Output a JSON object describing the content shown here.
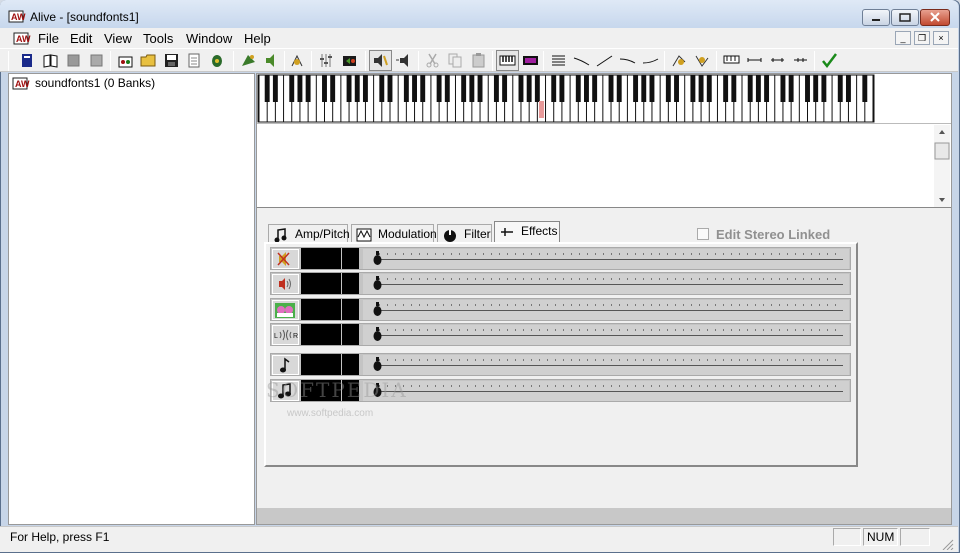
{
  "window": {
    "title": "Alive - [soundfonts1]",
    "title_icon": "alive-app-icon",
    "controls": [
      "minimize-icon",
      "maximize-icon",
      "close-icon"
    ]
  },
  "menubar": {
    "items": [
      "File",
      "Edit",
      "View",
      "Tools",
      "Window",
      "Help"
    ],
    "mdi_controls": [
      "minimize-icon",
      "restore-icon",
      "close-icon"
    ]
  },
  "toolbar": {
    "icons": [
      "new-bank-icon",
      "open-book-icon",
      "gray-box-icon",
      "gray-box-2-icon",
      "instrument-icon",
      "open-folder-icon",
      "save-icon",
      "page-icon",
      "bug-icon",
      "leaf-icon",
      "speaker-tool-icon",
      "mixer-icon",
      "equalizer-icon",
      "speaker-play-icon",
      "speaker-stop-icon",
      "cut-icon",
      "copy-icon",
      "paste-icon",
      "keyboard-icon",
      "purple-display-icon",
      "lines-icon",
      "line-diag-icon",
      "line-diag-2-icon",
      "curve-icon",
      "curve-2-icon",
      "tool-a-icon",
      "tool-b-icon",
      "keyboard-small-icon",
      "range-a-icon",
      "range-b-icon",
      "range-c-icon",
      "checkmark-icon"
    ]
  },
  "tree": {
    "root_label": "soundfonts1 (0 Banks)"
  },
  "tabs": [
    {
      "label": "Amp/Pitch",
      "icon": "note-icon"
    },
    {
      "label": "Modulation",
      "icon": "waveform-icon"
    },
    {
      "label": "Filter",
      "icon": "knob-icon"
    },
    {
      "label": "Effects",
      "icon": "effects-icon",
      "active": true
    }
  ],
  "stereo_link": {
    "label": "Edit Stereo Linked",
    "checked": false
  },
  "effects_rows": [
    {
      "icon": "muted-speaker-icon"
    },
    {
      "icon": "speaker-sound-icon"
    },
    {
      "icon": "reverb-icon"
    },
    {
      "icon": "pan-icon"
    },
    {
      "icon": "note-single-icon"
    },
    {
      "icon": "note-double-icon"
    }
  ],
  "watermark": {
    "text": "SOFTPEDIA",
    "subtext": "www.softpedia.com"
  },
  "statusbar": {
    "help_text": "For Help, press F1",
    "num_indicator": "NUM"
  },
  "colors": {
    "titlebar": "#c5d6ec",
    "panel": "#f0f0f0",
    "close_button": "#c24a30",
    "slider_track": "#c4c4c4"
  }
}
